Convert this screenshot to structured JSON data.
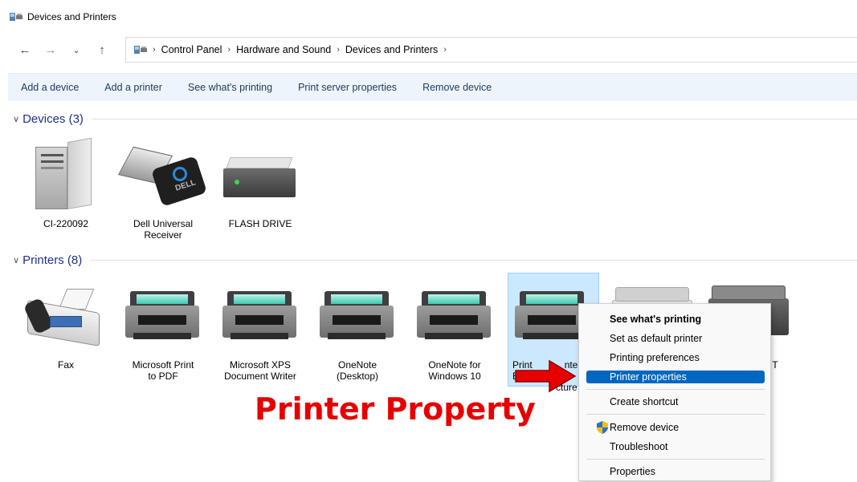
{
  "window": {
    "title": "Devices and Printers"
  },
  "nav": {
    "breadcrumb": [
      "Control Panel",
      "Hardware and Sound",
      "Devices and Printers"
    ]
  },
  "toolbar": {
    "items": [
      "Add a device",
      "Add a printer",
      "See what's printing",
      "Print server properties",
      "Remove device"
    ]
  },
  "groups": {
    "devices": {
      "header": "Devices (3)"
    },
    "printers": {
      "header": "Printers (8)"
    }
  },
  "devices": [
    {
      "label": "CI-220092",
      "icon": "computer-tower-icon"
    },
    {
      "label": "Dell Universal\nReceiver",
      "icon": "usb-receiver-icon"
    },
    {
      "label": "FLASH DRIVE",
      "icon": "flash-drive-icon"
    }
  ],
  "printers": [
    {
      "label": "Fax",
      "icon": "fax-icon"
    },
    {
      "label": "Microsoft Print\nto PDF",
      "icon": "printer-icon"
    },
    {
      "label": "Microsoft XPS\nDocument Writer",
      "icon": "printer-icon"
    },
    {
      "label": "OneNote\n(Desktop)",
      "icon": "printer-icon"
    },
    {
      "label": "OneNote for\nWindows 10",
      "icon": "printer-icon"
    },
    {
      "label_visible_part_1": "Print",
      "label_visible_part_2": "nter-Bu",
      "label_visible_line2": "cture",
      "icon": "printer-icon"
    },
    {
      "label_visible": "",
      "icon": "multifunction-printer-icon"
    },
    {
      "label_visible": "T",
      "icon": "multifunction-printer-icon"
    }
  ],
  "context_menu": {
    "items": [
      {
        "label": "See what's printing",
        "bold": true
      },
      {
        "label": "Set as default printer"
      },
      {
        "label": "Printing preferences"
      },
      {
        "label": "Printer properties",
        "highlighted": true
      },
      {
        "label": "Create shortcut"
      },
      {
        "label": "Remove device",
        "icon": "uac-shield-icon"
      },
      {
        "label": "Troubleshoot"
      },
      {
        "label": "Properties"
      }
    ]
  },
  "annotation": {
    "caption": "Printer Property",
    "color": "#e60000"
  },
  "colors": {
    "accent": "#0067c0",
    "selection": "#cce8ff",
    "group_header": "#1e3287"
  }
}
